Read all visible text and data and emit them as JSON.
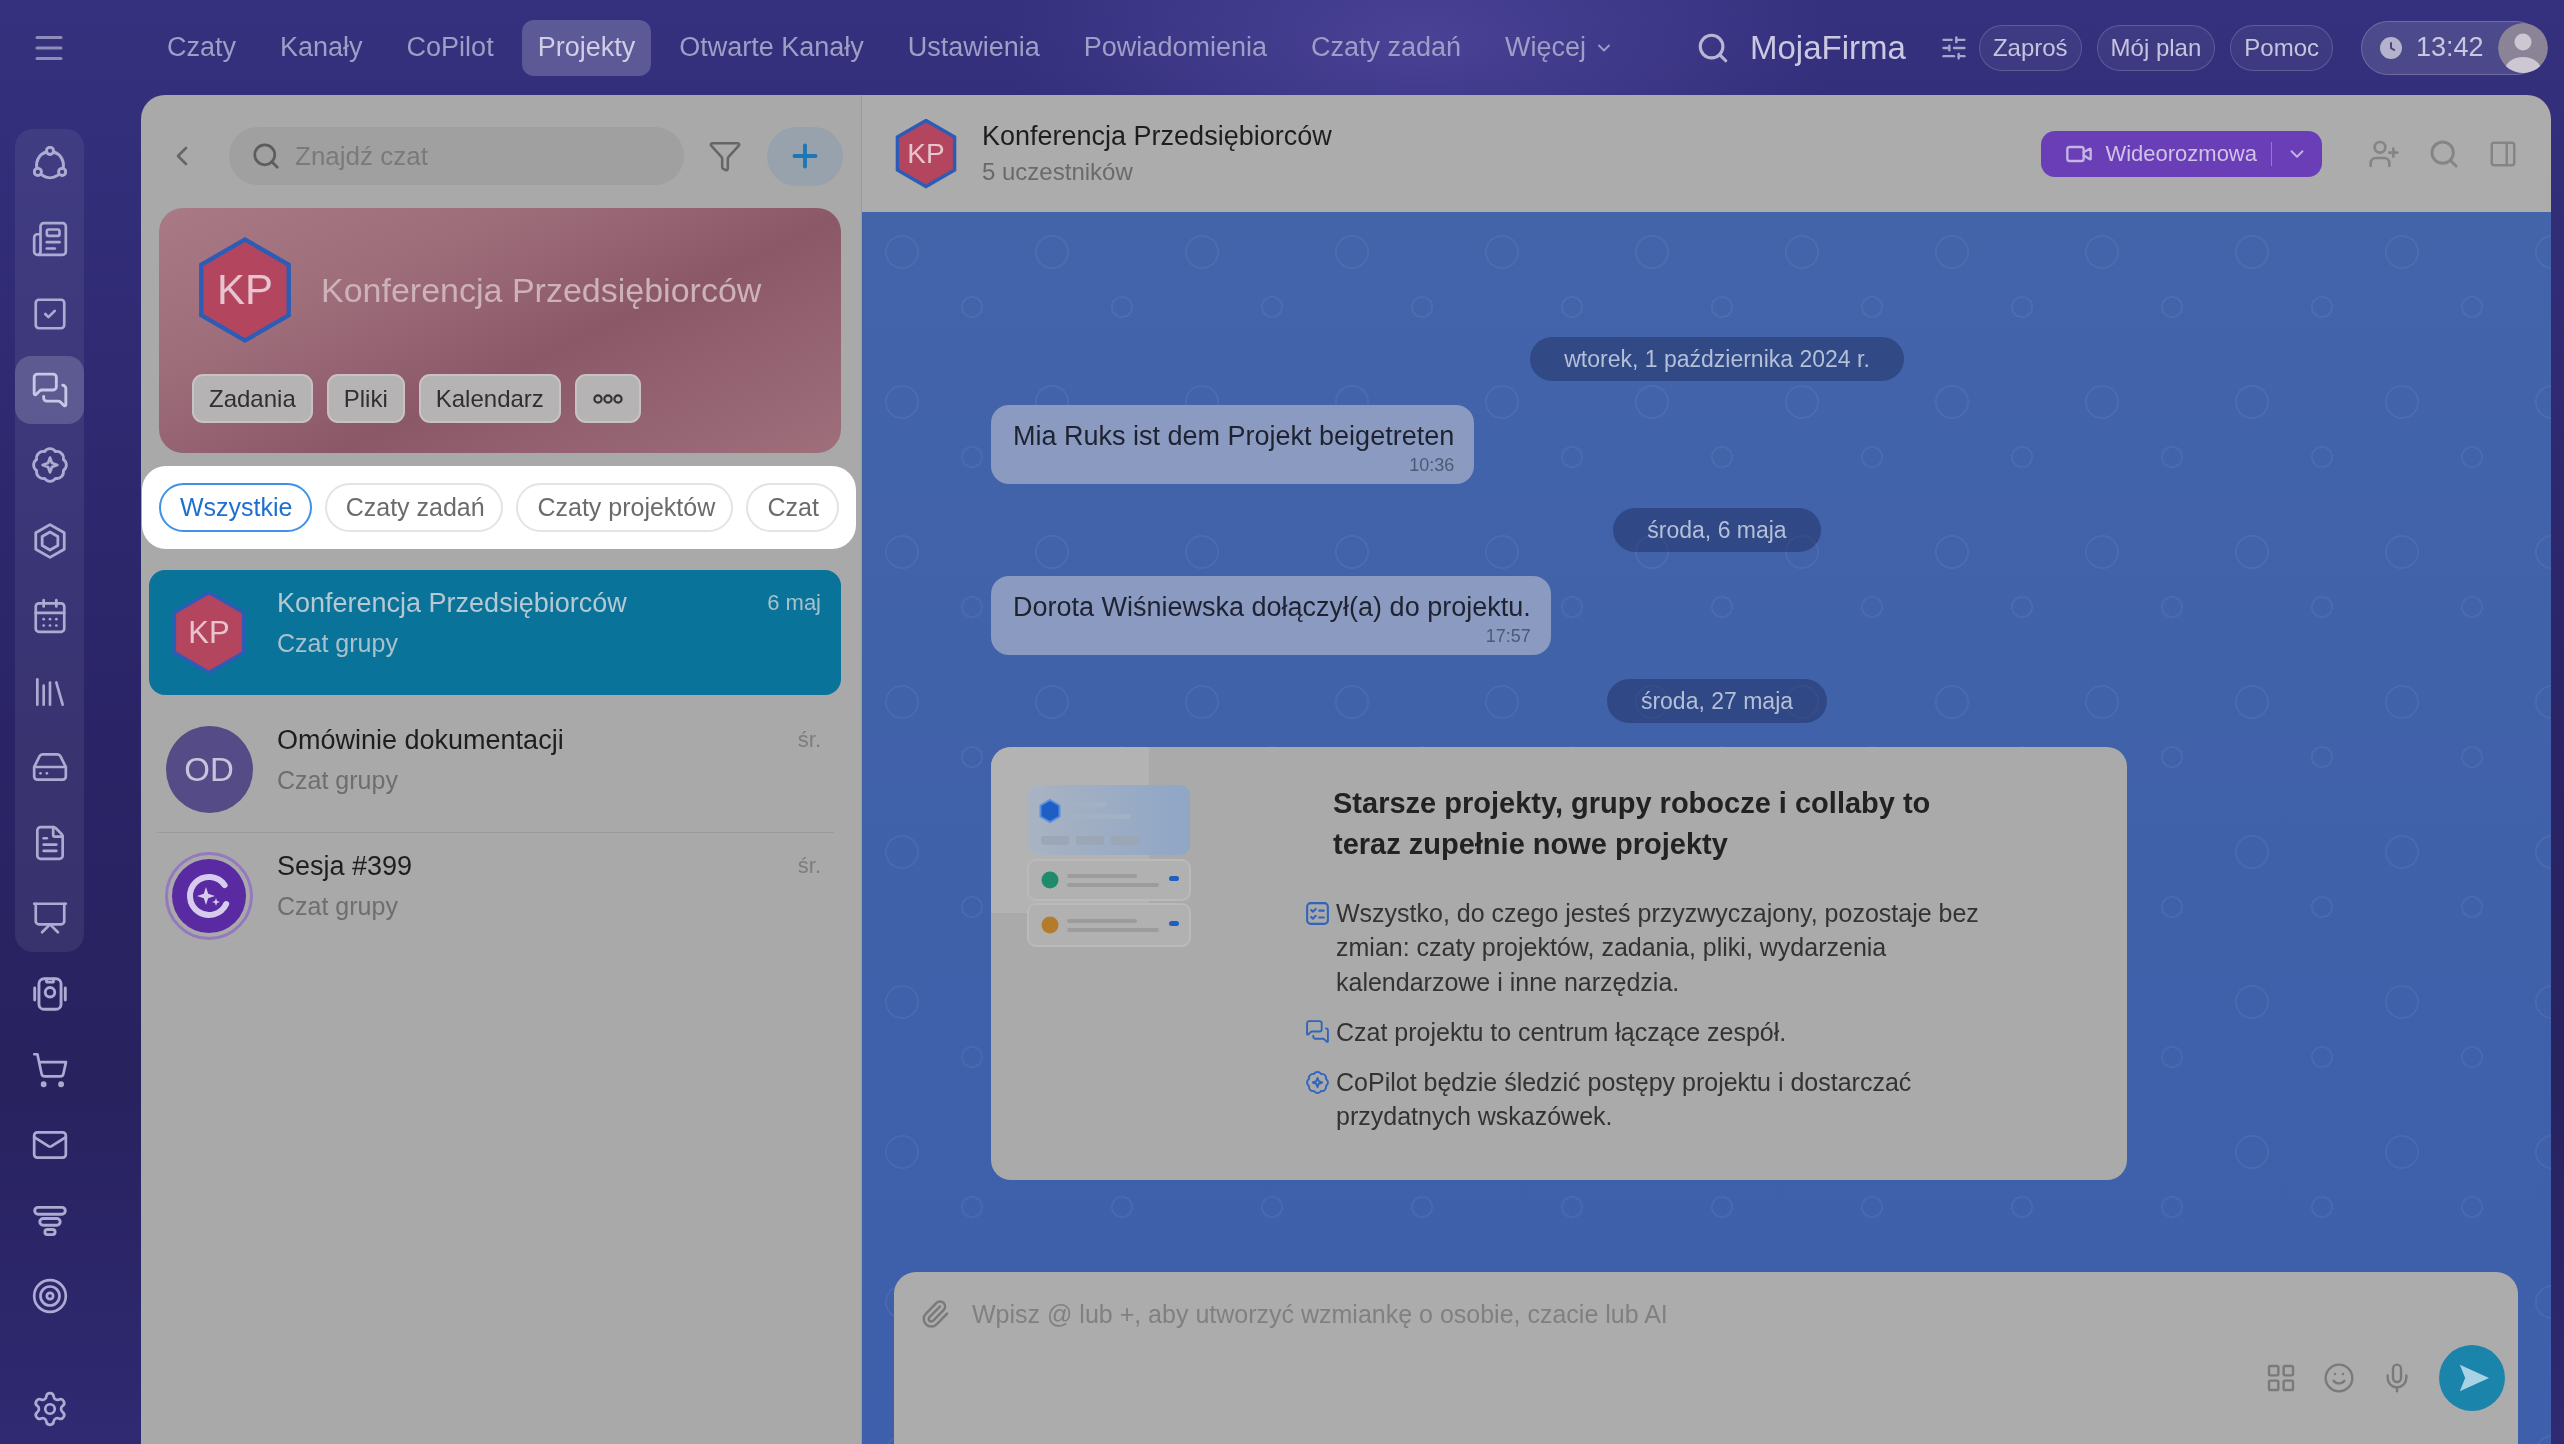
{
  "top_nav": {
    "items": [
      {
        "label": "Czaty",
        "kind": "link",
        "selected": false
      },
      {
        "label": "Kanały",
        "kind": "link",
        "selected": false
      },
      {
        "label": "CoPilot",
        "kind": "link",
        "selected": false
      },
      {
        "label": "Projekty",
        "kind": "link",
        "selected": true
      },
      {
        "label": "Otwarte Kanały",
        "kind": "link",
        "selected": false
      },
      {
        "label": "Ustawienia",
        "kind": "link",
        "selected": false
      },
      {
        "label": "Powiadomienia",
        "kind": "link",
        "selected": false
      },
      {
        "label": "Czaty zadań",
        "kind": "link",
        "selected": false
      },
      {
        "label": "Więcej",
        "kind": "menu",
        "selected": false
      }
    ],
    "company": "MojaFirma",
    "buttons": [
      "Zaproś",
      "Mój plan",
      "Pomoc"
    ],
    "clock": "13:42"
  },
  "rail": {
    "pinned": [
      {
        "selected": false
      },
      {
        "selected": false
      },
      {
        "selected": false
      },
      {
        "selected": true
      },
      {
        "selected": false
      },
      {
        "selected": false
      },
      {
        "selected": false
      },
      {
        "selected": false
      },
      {
        "selected": false
      },
      {
        "selected": false
      },
      {
        "selected": false
      }
    ],
    "more": [
      {
        "selected": false
      },
      {
        "selected": false
      },
      {
        "selected": false
      },
      {
        "selected": false
      },
      {
        "selected": false
      }
    ]
  },
  "chat_list": {
    "search": {
      "placeholder": "Znajdź czat"
    },
    "project": {
      "initials": "KP",
      "title": "Konferencja Przedsiębiorców",
      "shortcuts": [
        "Zadania",
        "Pliki",
        "Kalendarz"
      ]
    },
    "filters": [
      {
        "label": "Wszystkie",
        "selected": true
      },
      {
        "label": "Czaty zadań",
        "selected": false
      },
      {
        "label": "Czaty projektów",
        "selected": false
      },
      {
        "label": "Czat",
        "selected": false
      }
    ],
    "chats": [
      {
        "kind": "project",
        "initials": "KP",
        "title": "Konferencja Przedsiębiorców",
        "subtitle": "Czat grupy",
        "date": "6 maj",
        "selected": true
      },
      {
        "kind": "group",
        "initials": "OD",
        "title": "Omówinie dokumentacji",
        "subtitle": "Czat grupy",
        "date": "śr.",
        "selected": false
      },
      {
        "kind": "copilot",
        "title": "Sesja #399",
        "subtitle": "Czat grupy",
        "date": "śr.",
        "selected": false
      }
    ]
  },
  "chat": {
    "avatar_initials": "KP",
    "title": "Konferencja Przedsiębiorców",
    "subtitle": "5 uczestników",
    "call_button": "Wideorozmowa",
    "messages": [
      {
        "kind": "date",
        "text": "wtorek, 1 października 2024 r."
      },
      {
        "kind": "system",
        "text": "Mia Ruks ist dem Projekt beigetreten",
        "time": "10:36"
      },
      {
        "kind": "date",
        "text": "środa, 6 maja"
      },
      {
        "kind": "system",
        "text": "Dorota Wiśniewska dołączył(a) do projektu.",
        "time": "17:57"
      },
      {
        "kind": "date",
        "text": "środa, 27 maja"
      },
      {
        "kind": "info",
        "title": "Starsze projekty, grupy robocze i collaby to teraz zupełnie nowe projekty",
        "points": [
          "Wszystko, do czego jesteś przyzwyczajony, pozostaje bez zmian: czaty projektów, zadania, pliki, wydarzenia kalendarzowe i inne narzędzia.",
          "Czat projektu to centrum łączące zespół.",
          "CoPilot będzie śledzić postępy projektu i dostarczać przydatnych wskazówek."
        ]
      }
    ],
    "composer": {
      "placeholder": "Wpisz @ lub +, aby utworzyć wzmiankę o osobie, czacie lub AI"
    }
  }
}
